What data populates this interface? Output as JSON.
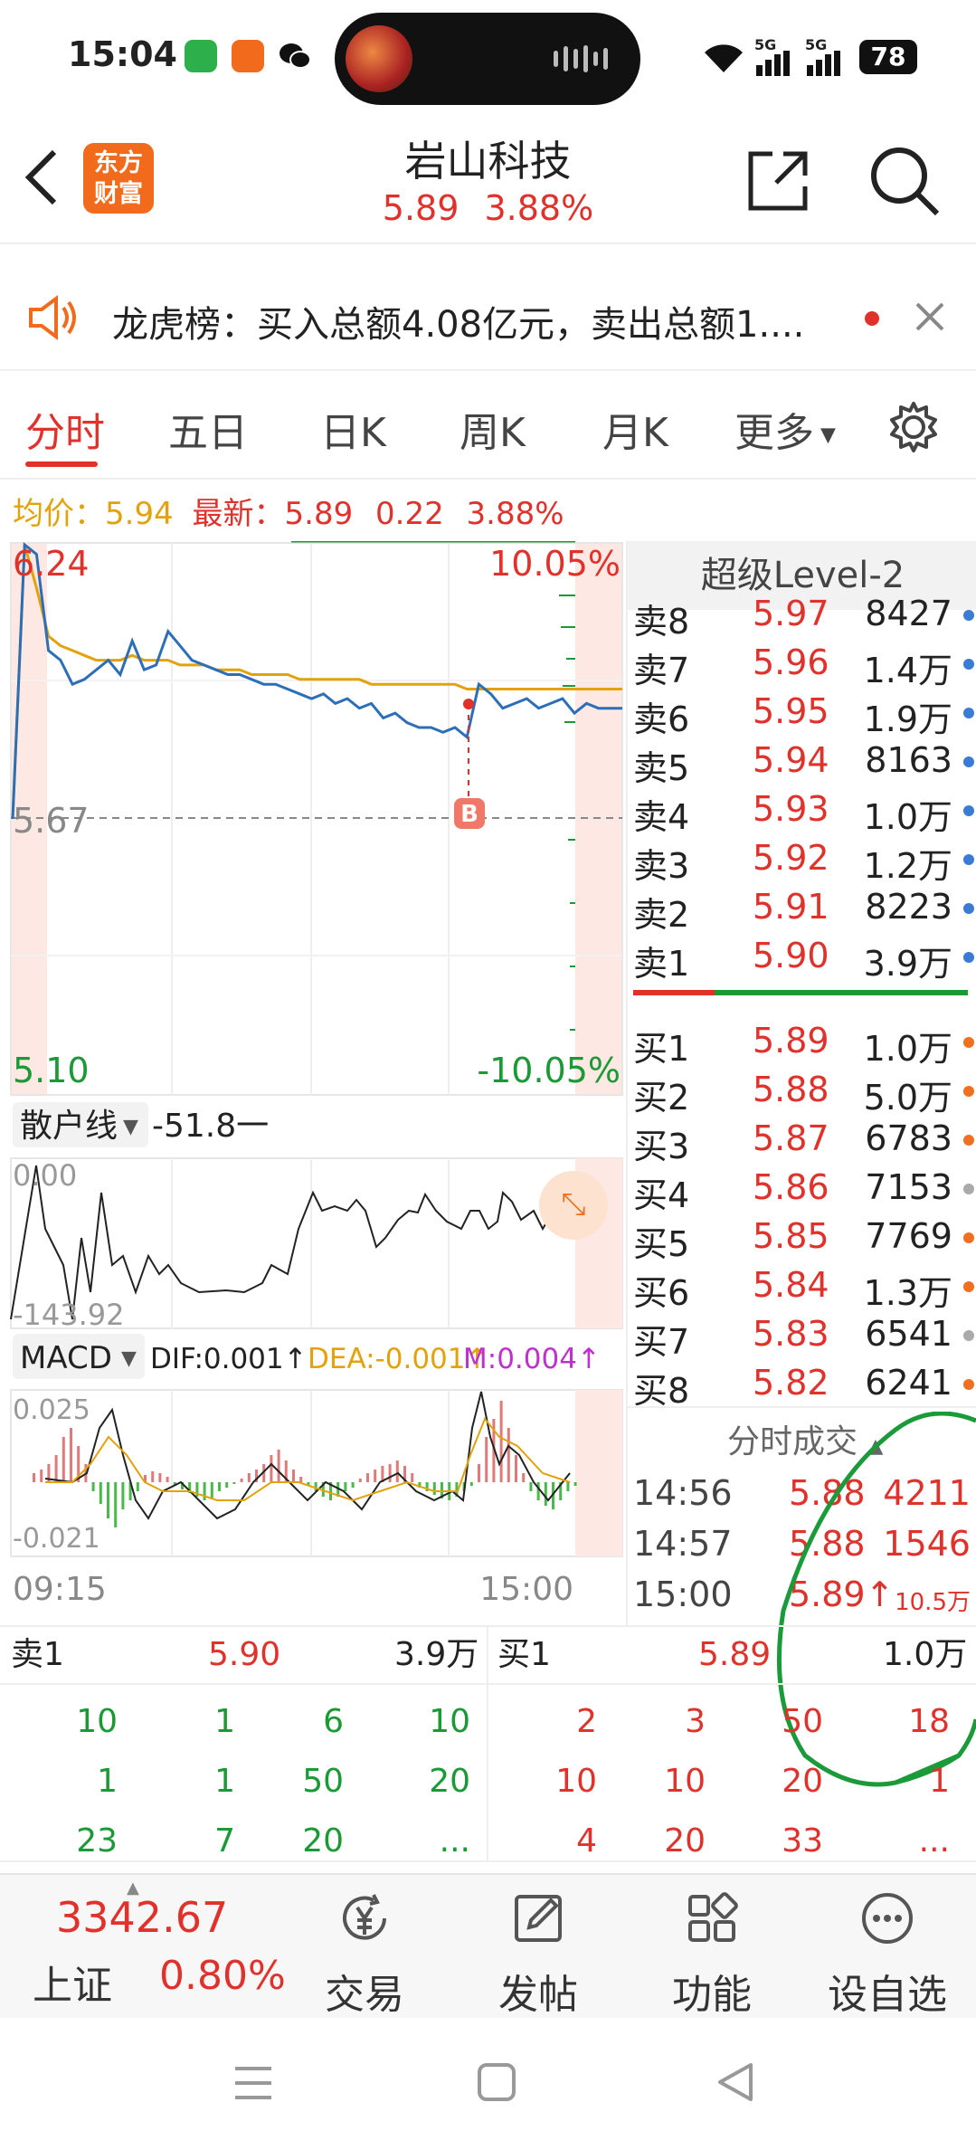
{
  "status_bar": {
    "time": "15:04",
    "battery": "78",
    "signal1": "5G",
    "signal2": "5G"
  },
  "header": {
    "logo_text": "东方\n财富",
    "stock_name": "岩山科技",
    "price": "5.89",
    "change_pct": "3.88%"
  },
  "notice": {
    "text": "龙虎榜：买入总额4.08亿元，卖出总额1...."
  },
  "tabs": {
    "items": [
      "分时",
      "五日",
      "日K",
      "周K",
      "月K",
      "更多"
    ],
    "active": "分时"
  },
  "info": {
    "avg_label": "均价：",
    "avg_value": "5.94",
    "latest_label": "最新：",
    "latest_value": "5.89",
    "change": "0.22",
    "change_pct": "3.88%"
  },
  "main_chart": {
    "y_high": "6.24",
    "y_mid": "5.67",
    "y_low": "5.10",
    "pct_high": "10.05%",
    "pct_low": "-10.05%",
    "marker": "B",
    "chart_data": {
      "type": "line",
      "series": [
        {
          "values": [
            5.67,
            6.24,
            6.22,
            6.02,
            6.0,
            5.95,
            5.96,
            5.98,
            6.0,
            5.97,
            6.04,
            5.98,
            5.99,
            6.06,
            6.03,
            6.0,
            5.99,
            5.98,
            5.97,
            5.97,
            5.96,
            5.95,
            5.95,
            5.94,
            5.93,
            5.92,
            5.93,
            5.91,
            5.92,
            5.9,
            5.91,
            5.88,
            5.89,
            5.87,
            5.86,
            5.86,
            5.85,
            5.86,
            5.84,
            5.95,
            5.93,
            5.9,
            5.91,
            5.92,
            5.9,
            5.91,
            5.92,
            5.89,
            5.91,
            5.9,
            5.9,
            5.9
          ]
        },
        {
          "values": [
            5.67,
            6.24,
            6.15,
            6.05,
            6.03,
            6.02,
            6.01,
            6.0,
            6.0,
            6.0,
            6.01,
            6.0,
            6.0,
            6.0,
            5.99,
            5.99,
            5.99,
            5.98,
            5.98,
            5.98,
            5.97,
            5.97,
            5.97,
            5.97,
            5.96,
            5.96,
            5.96,
            5.96,
            5.96,
            5.96,
            5.95,
            5.95,
            5.95,
            5.95,
            5.95,
            5.95,
            5.95,
            5.95,
            5.94,
            5.94,
            5.94,
            5.94,
            5.94,
            5.94,
            5.94,
            5.94,
            5.94,
            5.94,
            5.94,
            5.94,
            5.94,
            5.94
          ]
        }
      ],
      "ylim": [
        5.1,
        6.24
      ]
    }
  },
  "retail": {
    "dropdown_label": "散户线",
    "value": "-51.8一",
    "top": "0.00",
    "bottom": "-143.92"
  },
  "macd": {
    "dropdown_label": "MACD",
    "dif": "DIF:0.001",
    "dea": "DEA:-0.001",
    "m": "M:0.004",
    "top": "0.025",
    "bottom": "-0.021"
  },
  "time_axis": {
    "start": "09:15",
    "end": "15:00"
  },
  "level2": {
    "title": "超级Level-2",
    "asks": [
      {
        "label": "卖8",
        "price": "5.97",
        "vol": "8427",
        "dot": "#3a7bd5"
      },
      {
        "label": "卖7",
        "price": "5.96",
        "vol": "1.4万",
        "dot": "#3a7bd5"
      },
      {
        "label": "卖6",
        "price": "5.95",
        "vol": "1.9万",
        "dot": "#3a7bd5"
      },
      {
        "label": "卖5",
        "price": "5.94",
        "vol": "8163",
        "dot": "#3a7bd5"
      },
      {
        "label": "卖4",
        "price": "5.93",
        "vol": "1.0万",
        "dot": "#3a7bd5"
      },
      {
        "label": "卖3",
        "price": "5.92",
        "vol": "1.2万",
        "dot": "#3a7bd5"
      },
      {
        "label": "卖2",
        "price": "5.91",
        "vol": "8223",
        "dot": "#3a7bd5"
      },
      {
        "label": "卖1",
        "price": "5.90",
        "vol": "3.9万",
        "dot": "#3a7bd5"
      }
    ],
    "bids": [
      {
        "label": "买1",
        "price": "5.89",
        "vol": "1.0万",
        "dot": "#f07020"
      },
      {
        "label": "买2",
        "price": "5.88",
        "vol": "5.0万",
        "dot": "#f07020"
      },
      {
        "label": "买3",
        "price": "5.87",
        "vol": "6783",
        "dot": "#f07020"
      },
      {
        "label": "买4",
        "price": "5.86",
        "vol": "7153",
        "dot": "#aaaaaa"
      },
      {
        "label": "买5",
        "price": "5.85",
        "vol": "7769",
        "dot": "#f07020"
      },
      {
        "label": "买6",
        "price": "5.84",
        "vol": "1.3万",
        "dot": "#f07020"
      },
      {
        "label": "买7",
        "price": "5.83",
        "vol": "6541",
        "dot": "#aaaaaa"
      },
      {
        "label": "买8",
        "price": "5.82",
        "vol": "6241",
        "dot": "#f07020"
      }
    ],
    "trades_title": "分时成交",
    "trades": [
      {
        "time": "14:56",
        "price": "5.88",
        "vol": "4211"
      },
      {
        "time": "14:57",
        "price": "5.88",
        "vol": "1546"
      },
      {
        "time": "15:00",
        "price": "5.89↑",
        "vol": "10.5万"
      }
    ]
  },
  "queue": {
    "sell_label": "卖1",
    "sell_price": "5.90",
    "sell_vol": "3.9万",
    "buy_label": "买1",
    "buy_price": "5.89",
    "buy_vol": "1.0万",
    "sell_rows": [
      [
        "10",
        "1",
        "6",
        "10"
      ],
      [
        "1",
        "1",
        "50",
        "20"
      ],
      [
        "23",
        "7",
        "20",
        "..."
      ]
    ],
    "buy_rows": [
      [
        "2",
        "3",
        "50",
        "18"
      ],
      [
        "10",
        "10",
        "20",
        "1"
      ],
      [
        "4",
        "20",
        "33",
        "..."
      ]
    ]
  },
  "bottom_nav": {
    "index_value": "3342.67",
    "index_name": "上证",
    "index_pct": "0.80%",
    "items": [
      "交易",
      "发帖",
      "功能",
      "设自选"
    ]
  },
  "colors": {
    "up": "#e0312b",
    "down": "#1a9a35",
    "accent": "#f26a1b",
    "avg_line": "#e3a20b",
    "price_line": "#2c6fb8",
    "annotation": "#1b9a3a"
  }
}
